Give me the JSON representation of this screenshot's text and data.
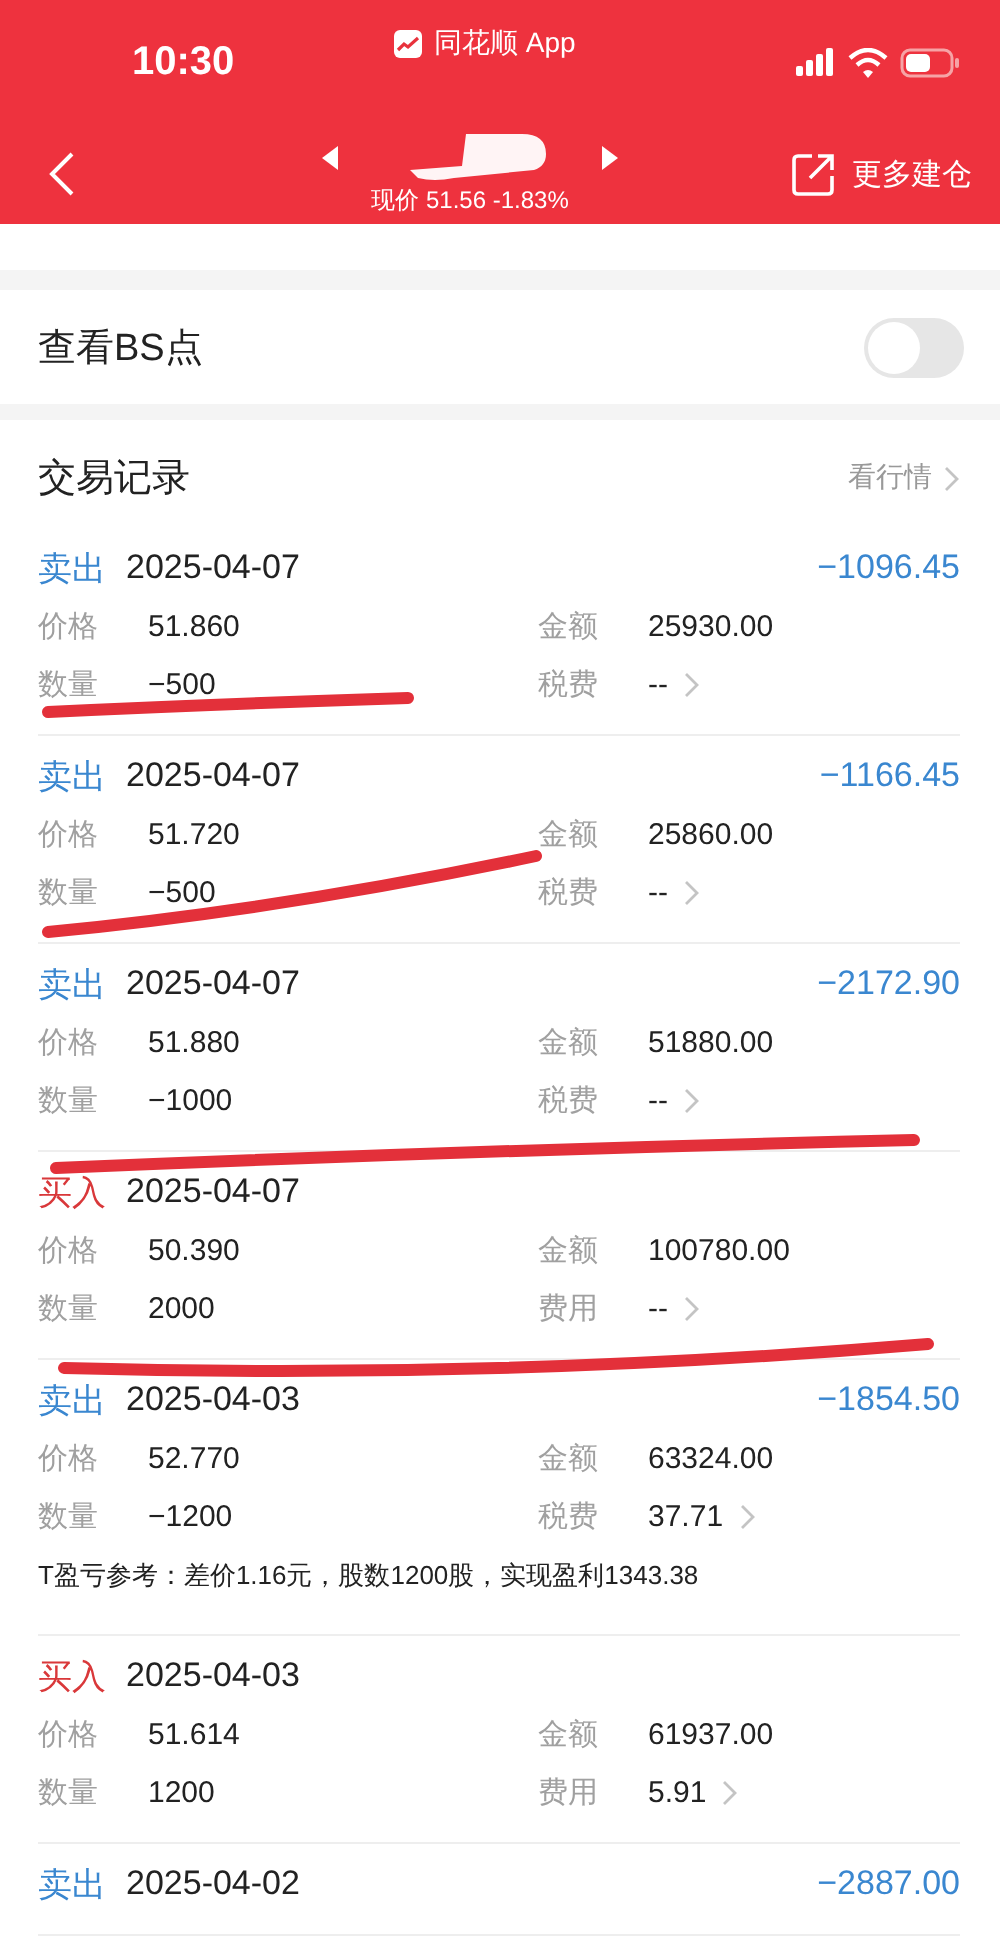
{
  "status_bar": {
    "time": "10:30",
    "app": "同花顺 App"
  },
  "nav": {
    "price_line": "现价 51.56 -1.83%",
    "action": "更多建仓"
  },
  "bs_toggle": {
    "label": "查看BS点",
    "on": false
  },
  "records": {
    "title": "交易记录",
    "link": "看行情",
    "trades": [
      {
        "kind": "sell",
        "side": "卖出",
        "date": "2025-04-07",
        "pnl": "−1096.45",
        "price_label": "价格",
        "price": "51.860",
        "amount_label": "金额",
        "amount": "25930.00",
        "qty_label": "数量",
        "qty": "−500",
        "fee_label": "税费",
        "fee": "--"
      },
      {
        "kind": "sell",
        "side": "卖出",
        "date": "2025-04-07",
        "pnl": "−1166.45",
        "price_label": "价格",
        "price": "51.720",
        "amount_label": "金额",
        "amount": "25860.00",
        "qty_label": "数量",
        "qty": "−500",
        "fee_label": "税费",
        "fee": "--"
      },
      {
        "kind": "sell",
        "side": "卖出",
        "date": "2025-04-07",
        "pnl": "−2172.90",
        "price_label": "价格",
        "price": "51.880",
        "amount_label": "金额",
        "amount": "51880.00",
        "qty_label": "数量",
        "qty": "−1000",
        "fee_label": "税费",
        "fee": "--"
      },
      {
        "kind": "buy",
        "side": "买入",
        "date": "2025-04-07",
        "price_label": "价格",
        "price": "50.390",
        "amount_label": "金额",
        "amount": "100780.00",
        "qty_label": "数量",
        "qty": "2000",
        "fee_label": "费用",
        "fee": "--"
      },
      {
        "kind": "sell",
        "side": "卖出",
        "date": "2025-04-03",
        "pnl": "−1854.50",
        "price_label": "价格",
        "price": "52.770",
        "amount_label": "金额",
        "amount": "63324.00",
        "qty_label": "数量",
        "qty": "−1200",
        "fee_label": "税费",
        "fee": "37.71",
        "note": "T盈亏参考：差价1.16元，股数1200股，实现盈利1343.38"
      },
      {
        "kind": "buy",
        "side": "买入",
        "date": "2025-04-03",
        "price_label": "价格",
        "price": "51.614",
        "amount_label": "金额",
        "amount": "61937.00",
        "qty_label": "数量",
        "qty": "1200",
        "fee_label": "费用",
        "fee": "5.91"
      },
      {
        "kind": "sell",
        "side": "卖出",
        "date": "2025-04-02",
        "pnl": "−2887.00"
      }
    ]
  }
}
